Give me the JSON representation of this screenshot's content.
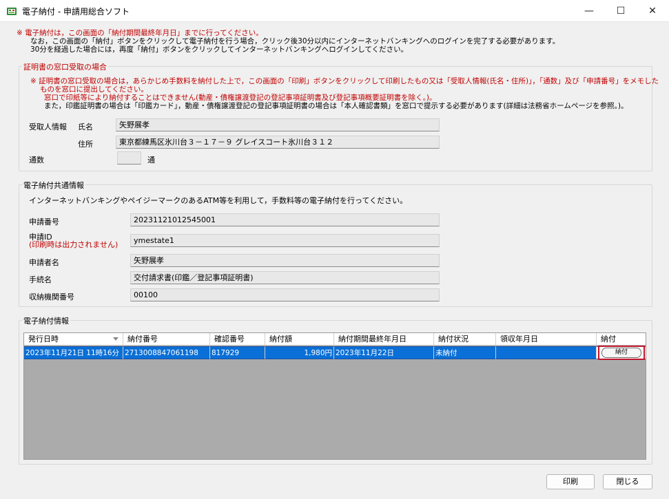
{
  "window": {
    "title": "電子納付 - 申請用総合ソフト",
    "controls": {
      "minimize": "—",
      "maximize": "☐",
      "close": "✕"
    }
  },
  "top_notice": {
    "line1": "※ 電子納付は，この画面の「納付期間最終年月日」までに行ってください。",
    "line2": "なお，この画面の「納付」ボタンをクリックして電子納付を行う場合，クリック後30分以内にインターネットバンキングへのログインを完了する必要があります。",
    "line3": "30分を経過した場合には，再度「納付」ボタンをクリックしてインターネットバンキングへログインしてください。"
  },
  "certificate": {
    "group_title": "証明書の窓口受取の場合",
    "note1": "※ 証明書の窓口受取の場合は，あらかじめ手数料を納付した上で，この画面の「印刷」ボタンをクリックして印刷したもの又は「受取人情報(氏名・住所)」，「通数」及び「申請番号」をメモした",
    "note2": "ものを窓口に提出してください。",
    "note3": "窓口で印紙等により納付することはできません(動産・債権譲渡登記の登記事項証明書及び登記事項概要証明書を除く。)。",
    "note4": "また，印鑑証明書の場合は「印鑑カード」，動産・債権譲渡登記の登記事項証明書の場合は「本人確認書類」を窓口で提示する必要があります(詳細は法務省ホームページを参照。)。",
    "recipient_label": "受取人情報",
    "name_label": "氏名",
    "name_value": "矢野展孝",
    "address_label": "住所",
    "address_value": "東京都練馬区氷川台３－１７－９ グレイスコート氷川台３１２",
    "copies_label": "通数",
    "copies_value": "",
    "copies_unit": "通"
  },
  "common": {
    "group_title": "電子納付共通情報",
    "description": "インターネットバンキングやペイジーマークのあるATM等を利用して，手数料等の電子納付を行ってください。",
    "application_no_label": "申請番号",
    "application_no_value": "20231121012545001",
    "application_id_label": "申請ID",
    "application_id_note": "(印刷時は出力されません)",
    "application_id_value": "ymestate1",
    "applicant_label": "申請者名",
    "applicant_value": "矢野展孝",
    "procedure_label": "手続名",
    "procedure_value": "交付請求書(印鑑／登記事項証明書)",
    "institution_label": "収納機関番号",
    "institution_value": "00100"
  },
  "payment": {
    "group_title": "電子納付情報",
    "columns": [
      "発行日時",
      "納付番号",
      "確認番号",
      "納付額",
      "納付期間最終年月日",
      "納付状況",
      "領収年月日",
      "納付"
    ],
    "rows": [
      {
        "issued": "2023年11月21日 11時16分",
        "payment_no": "2713008847061198",
        "confirmation_no": "817929",
        "amount": "1,980円",
        "deadline": "2023年11月22日",
        "status": "未納付",
        "received": "",
        "pay_button": "納付"
      }
    ]
  },
  "footer": {
    "print_label": "印刷",
    "close_label": "閉じる"
  },
  "colors": {
    "accent_red": "#c00000",
    "selection_blue": "#0a6fd6",
    "highlight_border": "#c0142a"
  }
}
